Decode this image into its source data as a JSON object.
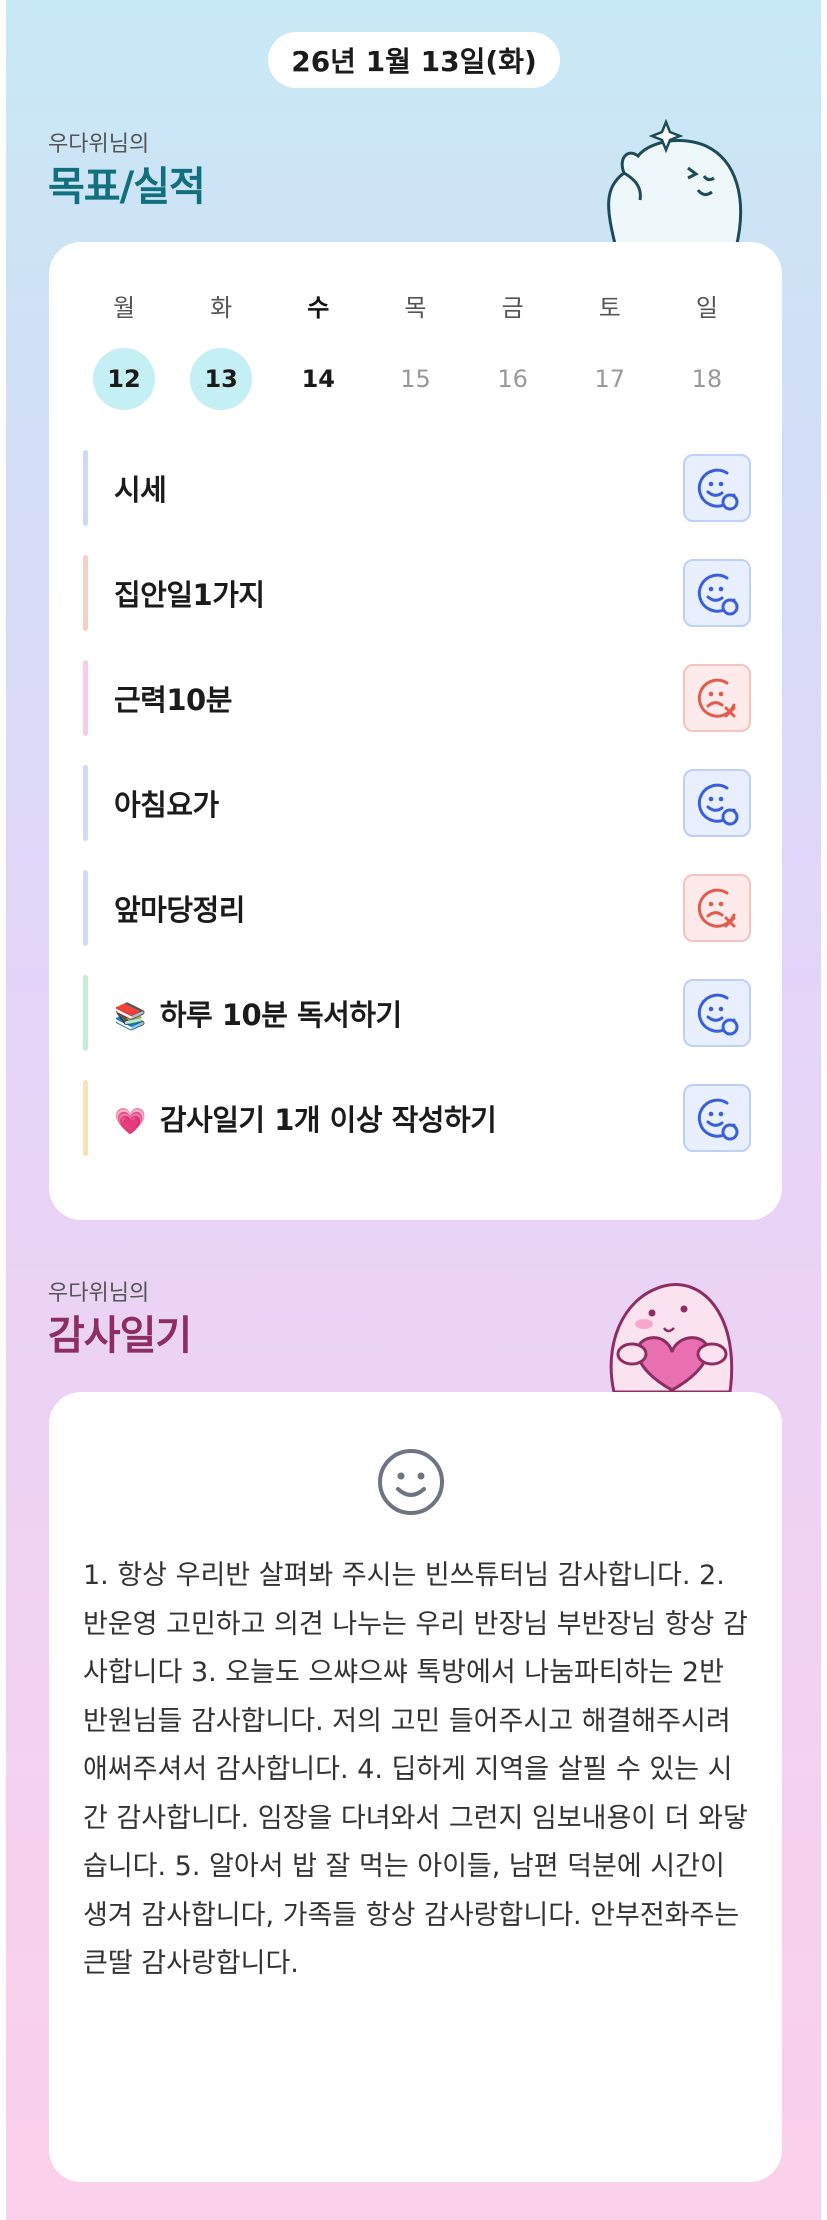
{
  "date_label": "26년 1월 13일(화)",
  "goals_section": {
    "owner": "우다위님의",
    "title": "목표/실적"
  },
  "week": {
    "days": [
      "월",
      "화",
      "수",
      "목",
      "금",
      "토",
      "일"
    ],
    "dates": [
      "12",
      "13",
      "14",
      "15",
      "16",
      "17",
      "18"
    ]
  },
  "goals": [
    {
      "label": "시세",
      "emoji": "",
      "status": "done",
      "accent": "#d0dcf7"
    },
    {
      "label": "집안일1가지",
      "emoji": "",
      "status": "done",
      "accent": "#f7cfc9"
    },
    {
      "label": "근력10분",
      "emoji": "",
      "status": "missed",
      "accent": "#f6cde6"
    },
    {
      "label": "아침요가",
      "emoji": "",
      "status": "done",
      "accent": "#d0dcf7"
    },
    {
      "label": "앞마당정리",
      "emoji": "",
      "status": "missed",
      "accent": "#d0dcf7"
    },
    {
      "label": "하루 10분 독서하기",
      "emoji": "📚",
      "status": "done",
      "accent": "#c6ecd8"
    },
    {
      "label": "감사일기 1개 이상 작성하기",
      "emoji": "💗",
      "status": "done",
      "accent": "#f5e4b8"
    }
  ],
  "diary_section": {
    "owner": "우다위님의",
    "title": "감사일기",
    "mood_icon": "smiley-icon",
    "text": "1. 항상 우리반 살펴봐 주시는 빈쓰튜터님 감사합니다.\n2. 반운영 고민하고 의견 나누는 우리 반장님 부반장님 항상 감사합니다\n3. 오늘도 으쌰으쌰 톡방에서 나눔파티하는 2반 반원님들 감사합니다. 저의 고민 들어주시고 해결해주시려 애써주셔서 감사합니다.\n4. 딥하게 지역을 살필 수 있는 시간 감사합니다. 임장을 다녀와서 그런지 임보내용이 더 와닿습니다.\n5. 알아서 밥 잘 먹는 아이들, 남편 덕분에 시간이 생겨 감사합니다, 가족들 항상 감사랑합니다. 안부전화주는 큰딸 감사랑합니다."
  },
  "colors": {
    "done": "#3a5fd8",
    "missed": "#e15c4d",
    "goals_title": "#12707e",
    "diary_title": "#8e2d63"
  }
}
